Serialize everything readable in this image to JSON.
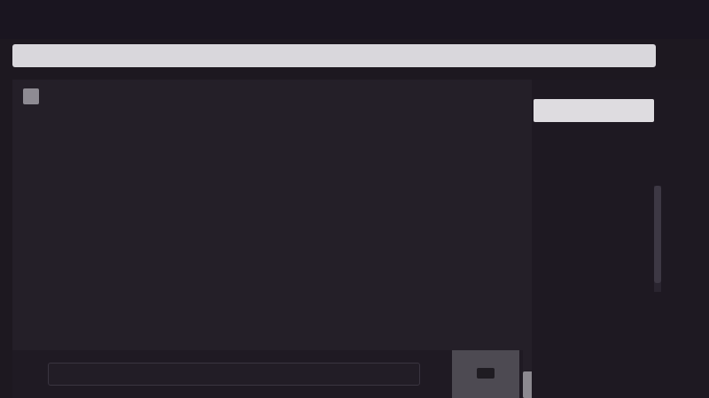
{
  "address_bar": {
    "text": ""
  },
  "content": {
    "heading": "",
    "lines": [
      "",
      "",
      "",
      "",
      ""
    ]
  },
  "sidebar": {
    "card_label": "",
    "items": [
      "",
      ""
    ]
  },
  "bottom_bar": {
    "input_placeholder": ""
  },
  "icons": {
    "content_icon": "app-icon",
    "side_button": "scroll-handle",
    "bottom_button": "send-icon"
  },
  "colors": {
    "background": "#1d1820",
    "panel": "#241f28",
    "address_bar": "#d9d7dc",
    "text": "#e6e3ea"
  }
}
